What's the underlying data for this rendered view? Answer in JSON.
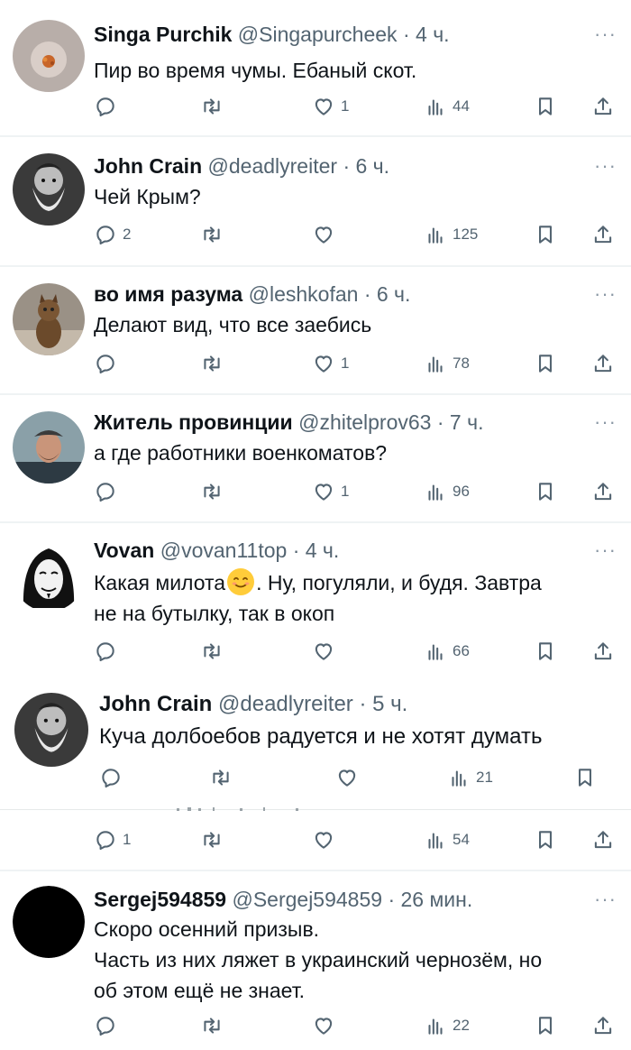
{
  "posts": [
    {
      "name": "Singa Purchik",
      "handle": "@Singapurcheek",
      "time": "4 ч.",
      "text": "Пир во время чумы. Ебаный скот.",
      "replies": "",
      "likes": "1",
      "views": "44"
    },
    {
      "name": "John Crain",
      "handle": "@deadlyreiter",
      "time": "6 ч.",
      "text": "Чей Крым?",
      "replies": "2",
      "likes": "",
      "views": "125"
    },
    {
      "name": "во имя разума",
      "handle": "@leshkofan",
      "time": "6 ч.",
      "text": "Делают вид, что все заебись",
      "replies": "",
      "likes": "1",
      "views": "78"
    },
    {
      "name": "Житель провинции",
      "handle": "@zhitelprov63",
      "time": "7 ч.",
      "text": "а где работники военкоматов?",
      "replies": "",
      "likes": "1",
      "views": "96"
    },
    {
      "name": "Vovan",
      "handle": "@vovan11top",
      "time": "4 ч.",
      "text_before_emoji": "Какая милота",
      "text_after_emoji": ". Ну, погуляли, и будя. Завтра",
      "text_line2": "не на бутылку, так в окоп",
      "replies": "",
      "likes": "",
      "views": "66"
    },
    {
      "name": "John Crain",
      "handle": "@deadlyreiter",
      "time": "5 ч.",
      "text": "Куча долбоебов радуется и не хотят думать",
      "replies": "",
      "likes": "",
      "views": "21"
    },
    {
      "replies": "1",
      "likes": "",
      "views": "54"
    },
    {
      "name": "Sergej594859",
      "handle": "@Sergej594859",
      "time": "26 мин.",
      "text_line1": "Скоро осенний призыв.",
      "text_line2": "Часть из них ляжет в украинский чернозём, но",
      "text_line3": "об этом ещё не знает.",
      "replies": "",
      "likes": "",
      "views": "22"
    }
  ],
  "more_label": "···",
  "dot": "·",
  "colors": {
    "text": "#0f1419",
    "secondary": "#536471",
    "divider": "#eff3f4"
  }
}
